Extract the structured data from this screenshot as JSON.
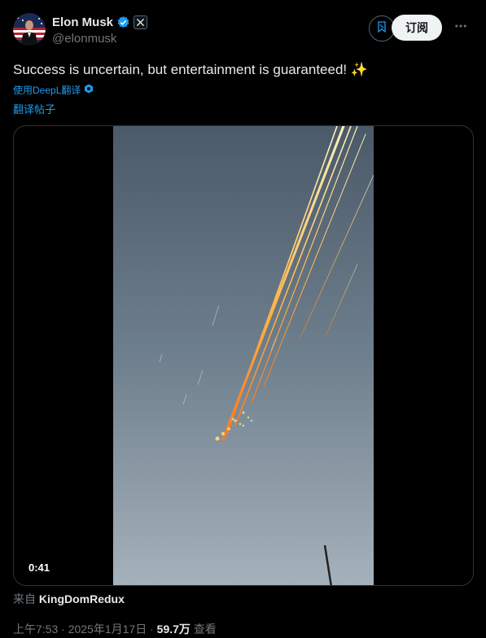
{
  "author": {
    "name": "Elon Musk",
    "handle": "@elonmusk"
  },
  "actions": {
    "subscribe_label": "订阅",
    "more_icon": "ellipsis-icon",
    "grok_icon": "grok-icon"
  },
  "tweet": {
    "text": "Success is uncertain, but entertainment is guaranteed! ✨",
    "translated_by": "使用DeepL翻译",
    "translate_link": "翻译帖子"
  },
  "media": {
    "duration": "0:41"
  },
  "source": {
    "prefix": "来自",
    "name": "KingDomRedux"
  },
  "meta": {
    "time": "上午7:53",
    "separator": "·",
    "date": "2025年1月17日",
    "views_count": "59.7万",
    "views_label": "查看"
  },
  "colors": {
    "accent": "#1d9bf0",
    "background": "#000000",
    "secondary_text": "#71767b"
  }
}
